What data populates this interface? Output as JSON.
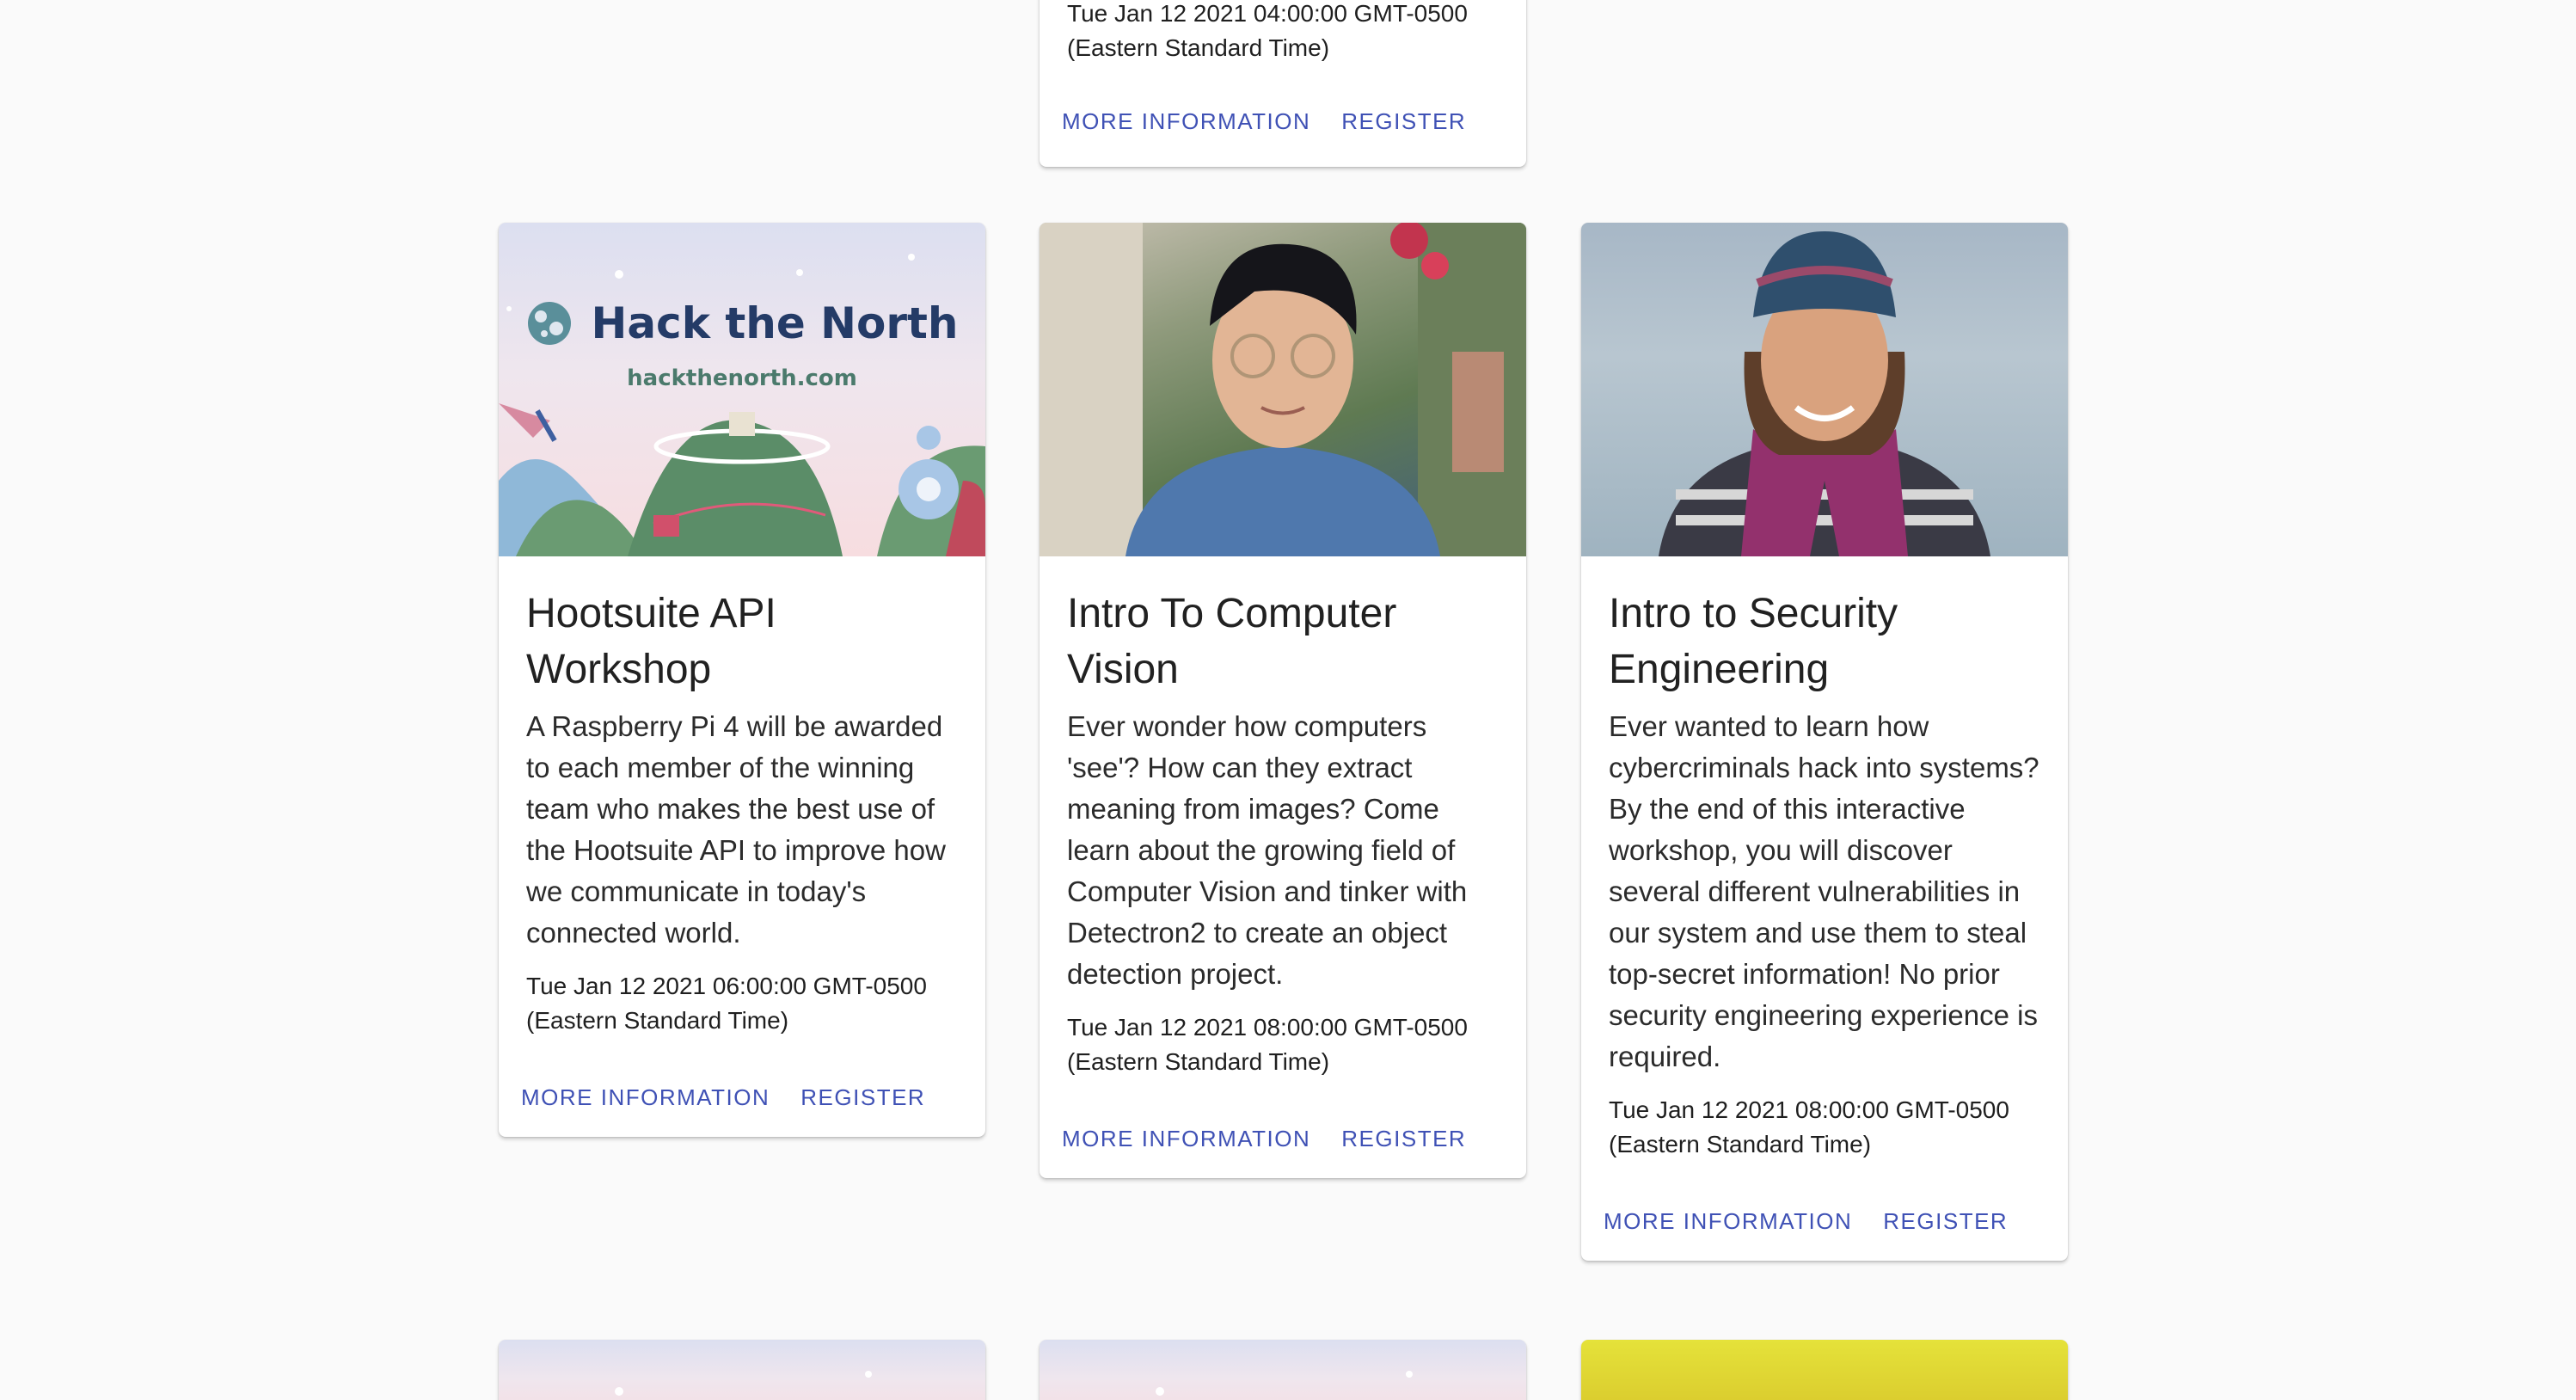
{
  "top_card": {
    "date": "Tue Jan 12 2021 04:00:00 GMT-0500 (Eastern Standard Time)",
    "more_label": "MORE INFORMATION",
    "register_label": "REGISTER"
  },
  "cards": [
    {
      "title": "Hootsuite API Workshop",
      "description": "A Raspberry Pi 4 will be awarded to each member of the winning team who makes the best use of the Hootsuite API to improve how we communicate in today's connected world.",
      "date": "Tue Jan 12 2021 06:00:00 GMT-0500 (Eastern Standard Time)",
      "media": {
        "logo_title": "Hack the North",
        "logo_url": "hackthenorth.com"
      },
      "more_label": "MORE INFORMATION",
      "register_label": "REGISTER"
    },
    {
      "title": "Intro To Computer Vision",
      "description": "Ever wonder how computers 'see'? How can they extract meaning from images? Come learn about the growing field of Computer Vision and tinker with Detectron2 to create an object detection project.",
      "date": "Tue Jan 12 2021 08:00:00 GMT-0500 (Eastern Standard Time)",
      "more_label": "MORE INFORMATION",
      "register_label": "REGISTER"
    },
    {
      "title": "Intro to Security Engineering",
      "description": "Ever wanted to learn how cybercriminals hack into systems? By the end of this interactive workshop, you will discover several different vulnerabilities in our system and use them to steal top-secret information! No prior security engineering experience is required.",
      "date": "Tue Jan 12 2021 08:00:00 GMT-0500 (Eastern Standard Time)",
      "more_label": "MORE INFORMATION",
      "register_label": "REGISTER"
    }
  ],
  "colors": {
    "page_background": "#fafafa",
    "card_background": "#ffffff",
    "action_text": "#3f51b5",
    "title_text": "#212121"
  }
}
